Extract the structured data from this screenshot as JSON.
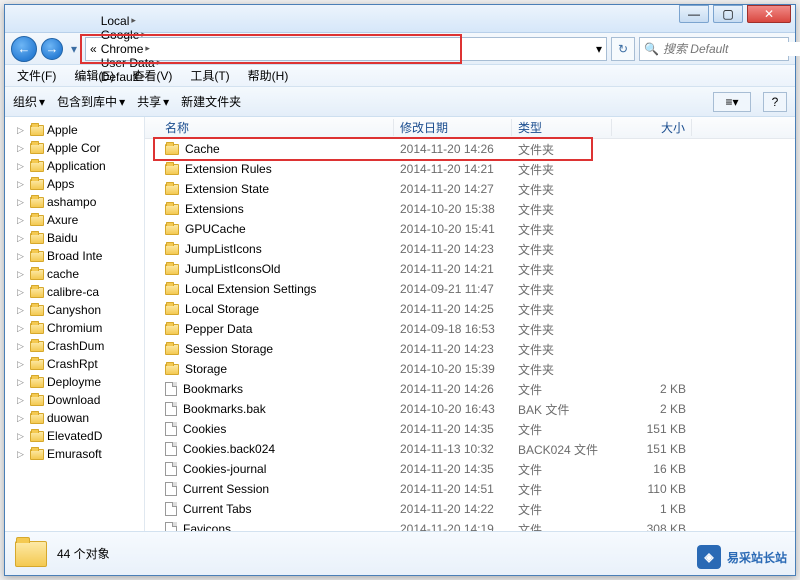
{
  "window_controls": {
    "min": "—",
    "max": "▢",
    "close": "✕"
  },
  "breadcrumb": [
    "Local",
    "Google",
    "Chrome",
    "User Data",
    "Default"
  ],
  "breadcrumb_prefix": "«",
  "address_dropdown": "▾",
  "refresh_icon": "↻",
  "search": {
    "placeholder": "搜索 Default",
    "icon": "🔍"
  },
  "menubar": [
    "文件(F)",
    "编辑(E)",
    "查看(V)",
    "工具(T)",
    "帮助(H)"
  ],
  "toolbar": {
    "organize": "组织",
    "include": "包含到库中",
    "share": "共享",
    "newfolder": "新建文件夹",
    "viewicon": "≡",
    "help": "?"
  },
  "tree": [
    {
      "name": "Apple",
      "type": "folder"
    },
    {
      "name": "Apple Cor",
      "type": "folder"
    },
    {
      "name": "Application",
      "type": "app"
    },
    {
      "name": "Apps",
      "type": "folder"
    },
    {
      "name": "ashampo",
      "type": "folder"
    },
    {
      "name": "Axure",
      "type": "folder"
    },
    {
      "name": "Baidu",
      "type": "folder"
    },
    {
      "name": "Broad Inte",
      "type": "folder"
    },
    {
      "name": "cache",
      "type": "folder"
    },
    {
      "name": "calibre-ca",
      "type": "folder"
    },
    {
      "name": "Canyshon",
      "type": "folder"
    },
    {
      "name": "Chromium",
      "type": "folder"
    },
    {
      "name": "CrashDum",
      "type": "folder"
    },
    {
      "name": "CrashRpt",
      "type": "folder"
    },
    {
      "name": "Deployme",
      "type": "folder"
    },
    {
      "name": "Download",
      "type": "folder"
    },
    {
      "name": "duowan",
      "type": "folder"
    },
    {
      "name": "ElevatedD",
      "type": "folder"
    },
    {
      "name": "Emurasoft",
      "type": "folder"
    }
  ],
  "columns": {
    "name": "名称",
    "date": "修改日期",
    "type": "类型",
    "size": "大小"
  },
  "files": [
    {
      "name": "Cache",
      "date": "2014-11-20 14:26",
      "type": "文件夹",
      "size": "",
      "icon": "folder"
    },
    {
      "name": "Extension Rules",
      "date": "2014-11-20 14:21",
      "type": "文件夹",
      "size": "",
      "icon": "folder"
    },
    {
      "name": "Extension State",
      "date": "2014-11-20 14:27",
      "type": "文件夹",
      "size": "",
      "icon": "folder"
    },
    {
      "name": "Extensions",
      "date": "2014-10-20 15:38",
      "type": "文件夹",
      "size": "",
      "icon": "folder"
    },
    {
      "name": "GPUCache",
      "date": "2014-10-20 15:41",
      "type": "文件夹",
      "size": "",
      "icon": "folder"
    },
    {
      "name": "JumpListIcons",
      "date": "2014-11-20 14:23",
      "type": "文件夹",
      "size": "",
      "icon": "folder"
    },
    {
      "name": "JumpListIconsOld",
      "date": "2014-11-20 14:21",
      "type": "文件夹",
      "size": "",
      "icon": "folder"
    },
    {
      "name": "Local Extension Settings",
      "date": "2014-09-21 11:47",
      "type": "文件夹",
      "size": "",
      "icon": "folder"
    },
    {
      "name": "Local Storage",
      "date": "2014-11-20 14:25",
      "type": "文件夹",
      "size": "",
      "icon": "folder"
    },
    {
      "name": "Pepper Data",
      "date": "2014-09-18 16:53",
      "type": "文件夹",
      "size": "",
      "icon": "folder"
    },
    {
      "name": "Session Storage",
      "date": "2014-11-20 14:23",
      "type": "文件夹",
      "size": "",
      "icon": "folder"
    },
    {
      "name": "Storage",
      "date": "2014-10-20 15:39",
      "type": "文件夹",
      "size": "",
      "icon": "folder"
    },
    {
      "name": "Bookmarks",
      "date": "2014-11-20 14:26",
      "type": "文件",
      "size": "2 KB",
      "icon": "file"
    },
    {
      "name": "Bookmarks.bak",
      "date": "2014-10-20 16:43",
      "type": "BAK 文件",
      "size": "2 KB",
      "icon": "file"
    },
    {
      "name": "Cookies",
      "date": "2014-11-20 14:35",
      "type": "文件",
      "size": "151 KB",
      "icon": "file"
    },
    {
      "name": "Cookies.back024",
      "date": "2014-11-13 10:32",
      "type": "BACK024 文件",
      "size": "151 KB",
      "icon": "file"
    },
    {
      "name": "Cookies-journal",
      "date": "2014-11-20 14:35",
      "type": "文件",
      "size": "16 KB",
      "icon": "file"
    },
    {
      "name": "Current Session",
      "date": "2014-11-20 14:51",
      "type": "文件",
      "size": "110 KB",
      "icon": "file"
    },
    {
      "name": "Current Tabs",
      "date": "2014-11-20 14:22",
      "type": "文件",
      "size": "1 KB",
      "icon": "file"
    },
    {
      "name": "Favicons",
      "date": "2014-11-20 14:19",
      "type": "文件",
      "size": "308 KB",
      "icon": "file"
    }
  ],
  "status": {
    "count": "44 个对象"
  },
  "watermark": "易采站长站"
}
